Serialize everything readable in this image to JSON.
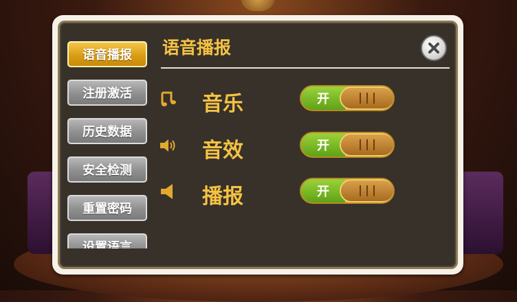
{
  "sidebar": {
    "items": [
      {
        "label": "语音播报",
        "active": true
      },
      {
        "label": "注册激活",
        "active": false
      },
      {
        "label": "历史数据",
        "active": false
      },
      {
        "label": "安全检测",
        "active": false
      },
      {
        "label": "重置密码",
        "active": false
      },
      {
        "label": "设置语言",
        "active": false
      }
    ]
  },
  "section": {
    "title": "语音播报"
  },
  "settings": [
    {
      "label": "音乐",
      "icon": "music-note-icon",
      "toggle_text": "开",
      "on": true
    },
    {
      "label": "音效",
      "icon": "speaker-sound-icon",
      "toggle_text": "开",
      "on": true
    },
    {
      "label": "播报",
      "icon": "speaker-icon",
      "toggle_text": "开",
      "on": true
    }
  ],
  "colors": {
    "accent": "#f5c243",
    "panel": "#37312a",
    "toggle_on": "#6fb31c",
    "tab_active": "#e0a322",
    "tab_inactive": "#999999"
  }
}
